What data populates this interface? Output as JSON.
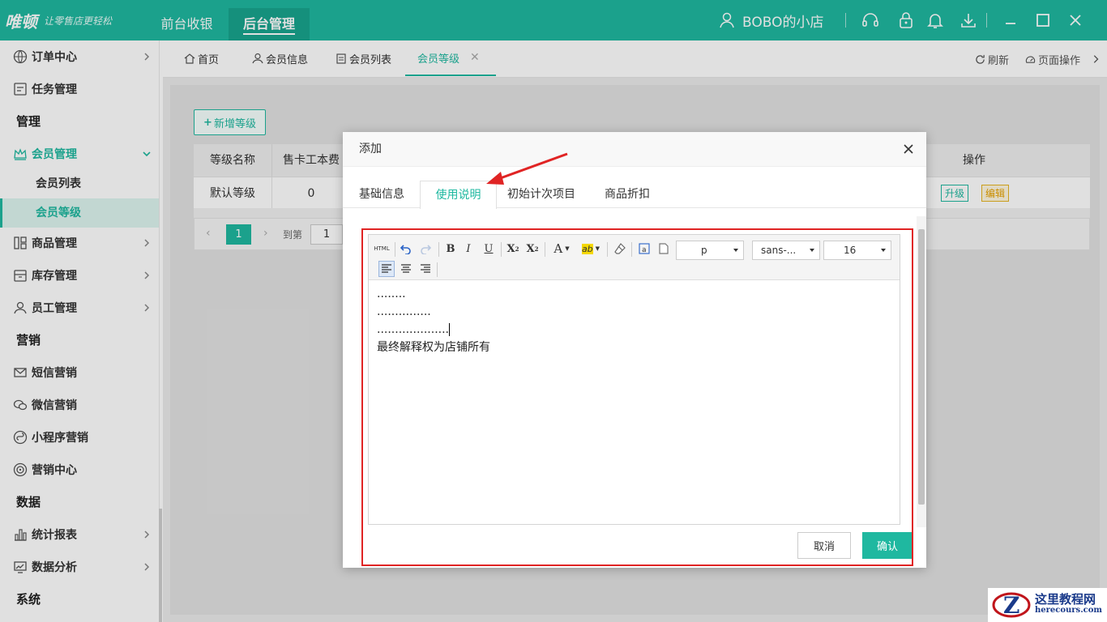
{
  "app": {
    "logo_main": "唯顿",
    "logo_sub": "让零售店更轻松",
    "top_tabs": [
      "前台收银",
      "后台管理"
    ],
    "store_name": "BOBO的小店"
  },
  "sidebar": {
    "items": [
      {
        "label": "订单中心",
        "icon": "globe-icon"
      },
      {
        "label": "任务管理",
        "icon": "task-icon"
      },
      {
        "group": "管理"
      },
      {
        "label": "会员管理",
        "icon": "crown-icon"
      },
      {
        "sub": "会员列表"
      },
      {
        "sub": "会员等级"
      },
      {
        "label": "商品管理",
        "icon": "grid-icon"
      },
      {
        "label": "库存管理",
        "icon": "box-icon"
      },
      {
        "label": "员工管理",
        "icon": "user-icon"
      },
      {
        "group": "营销"
      },
      {
        "label": "短信营销",
        "icon": "mail-icon"
      },
      {
        "label": "微信营销",
        "icon": "wechat-icon"
      },
      {
        "label": "小程序营销",
        "icon": "miniapp-icon"
      },
      {
        "label": "营销中心",
        "icon": "target-icon"
      },
      {
        "group": "数据"
      },
      {
        "label": "统计报表",
        "icon": "bar-chart-icon"
      },
      {
        "label": "数据分析",
        "icon": "analysis-icon"
      },
      {
        "group": "系统"
      }
    ]
  },
  "page_tabs": {
    "tabs": [
      "首页",
      "会员信息",
      "会员列表",
      "会员等级"
    ],
    "refresh": "刷新",
    "page_ops": "页面操作"
  },
  "level_page": {
    "add_button": "新增等级",
    "columns": [
      "等级名称",
      "售卡工本费",
      "操作"
    ],
    "rows": [
      {
        "name": "默认等级",
        "fee": "0"
      }
    ],
    "row_actions": [
      "升级",
      "编辑"
    ],
    "pager": {
      "current": "1",
      "goto_label": "到第",
      "goto_value": "1"
    }
  },
  "modal": {
    "title": "添加",
    "tabs": [
      "基础信息",
      "使用说明",
      "初始计次项目",
      "商品折扣"
    ],
    "active_tab": "使用说明",
    "editor": {
      "toolbar": {
        "html_label": "HTML",
        "format_value": "p",
        "font_value": "sans-...",
        "size_value": "16"
      },
      "lines": [
        "........",
        "...............",
        "....................",
        "最终解释权为店铺所有"
      ]
    },
    "cancel_label": "取消",
    "confirm_label": "确认"
  },
  "watermark": {
    "title": "这里教程网",
    "url": "herecours.com"
  },
  "colors": {
    "accent": "#1fb8a0",
    "highlight": "#e02424",
    "warning": "#e6a100"
  }
}
